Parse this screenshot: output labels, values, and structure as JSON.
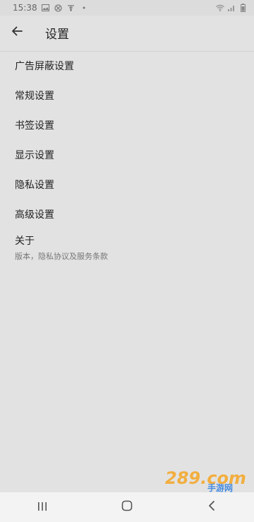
{
  "status_bar": {
    "time": "15:38"
  },
  "header": {
    "title": "设置"
  },
  "menu": {
    "items": [
      {
        "label": "广告屏蔽设置"
      },
      {
        "label": "常规设置"
      },
      {
        "label": "书签设置"
      },
      {
        "label": "显示设置"
      },
      {
        "label": "隐私设置"
      },
      {
        "label": "高级设置"
      }
    ],
    "about": {
      "label": "关于",
      "subtitle": "版本，隐私协议及服务条款"
    }
  },
  "watermark": {
    "brand": "289.com",
    "tagline": "手游网"
  },
  "icons": {
    "back": "arrow-left-icon",
    "recents": "recents-icon",
    "home": "home-icon",
    "nav_back": "chevron-left-icon"
  },
  "colors": {
    "background": "#e2e2e2",
    "nav_bar": "#f3f3f3",
    "watermark_orange": "#f5a623",
    "watermark_blue": "#2a7de1"
  }
}
